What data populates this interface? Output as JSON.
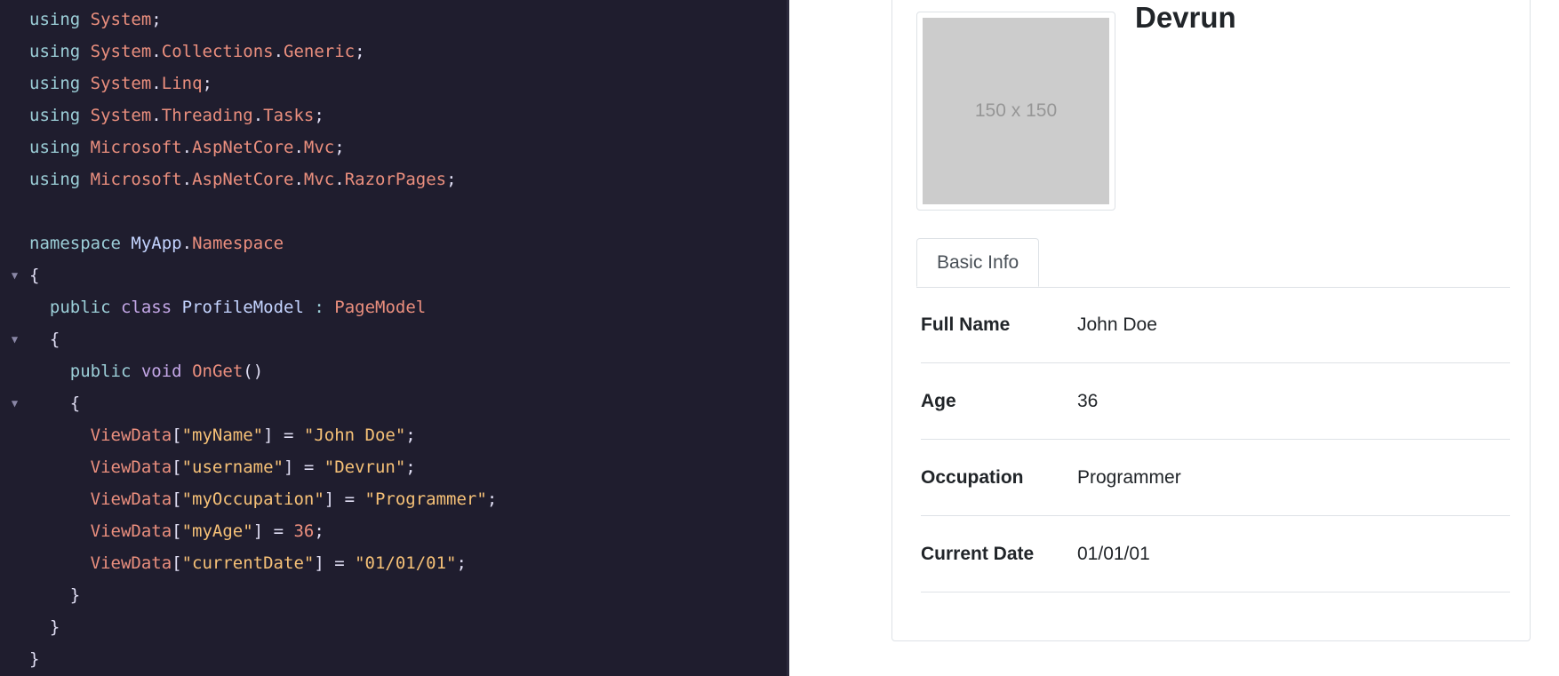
{
  "editor": {
    "lines": [
      {
        "fold": "",
        "indent": "",
        "tokens": [
          {
            "t": "using",
            "c": "kw"
          },
          {
            "t": " ",
            "c": "punc"
          },
          {
            "t": "System",
            "c": "type"
          },
          {
            "t": ";",
            "c": "punc"
          }
        ]
      },
      {
        "fold": "",
        "indent": "",
        "tokens": [
          {
            "t": "using",
            "c": "kw"
          },
          {
            "t": " ",
            "c": "punc"
          },
          {
            "t": "System",
            "c": "type"
          },
          {
            "t": ".",
            "c": "punc"
          },
          {
            "t": "Collections",
            "c": "type"
          },
          {
            "t": ".",
            "c": "punc"
          },
          {
            "t": "Generic",
            "c": "type"
          },
          {
            "t": ";",
            "c": "punc"
          }
        ]
      },
      {
        "fold": "",
        "indent": "",
        "tokens": [
          {
            "t": "using",
            "c": "kw"
          },
          {
            "t": " ",
            "c": "punc"
          },
          {
            "t": "System",
            "c": "type"
          },
          {
            "t": ".",
            "c": "punc"
          },
          {
            "t": "Linq",
            "c": "type"
          },
          {
            "t": ";",
            "c": "punc"
          }
        ]
      },
      {
        "fold": "",
        "indent": "",
        "tokens": [
          {
            "t": "using",
            "c": "kw"
          },
          {
            "t": " ",
            "c": "punc"
          },
          {
            "t": "System",
            "c": "type"
          },
          {
            "t": ".",
            "c": "punc"
          },
          {
            "t": "Threading",
            "c": "type"
          },
          {
            "t": ".",
            "c": "punc"
          },
          {
            "t": "Tasks",
            "c": "type"
          },
          {
            "t": ";",
            "c": "punc"
          }
        ]
      },
      {
        "fold": "",
        "indent": "",
        "tokens": [
          {
            "t": "using",
            "c": "kw"
          },
          {
            "t": " ",
            "c": "punc"
          },
          {
            "t": "Microsoft",
            "c": "type"
          },
          {
            "t": ".",
            "c": "punc"
          },
          {
            "t": "AspNetCore",
            "c": "type"
          },
          {
            "t": ".",
            "c": "punc"
          },
          {
            "t": "Mvc",
            "c": "type"
          },
          {
            "t": ";",
            "c": "punc"
          }
        ]
      },
      {
        "fold": "",
        "indent": "",
        "tokens": [
          {
            "t": "using",
            "c": "kw"
          },
          {
            "t": " ",
            "c": "punc"
          },
          {
            "t": "Microsoft",
            "c": "type"
          },
          {
            "t": ".",
            "c": "punc"
          },
          {
            "t": "AspNetCore",
            "c": "type"
          },
          {
            "t": ".",
            "c": "punc"
          },
          {
            "t": "Mvc",
            "c": "type"
          },
          {
            "t": ".",
            "c": "punc"
          },
          {
            "t": "RazorPages",
            "c": "type"
          },
          {
            "t": ";",
            "c": "punc"
          }
        ]
      },
      {
        "fold": "",
        "indent": "",
        "tokens": []
      },
      {
        "fold": "",
        "indent": "",
        "tokens": [
          {
            "t": "namespace",
            "c": "kw"
          },
          {
            "t": " ",
            "c": "punc"
          },
          {
            "t": "MyApp",
            "c": "ident"
          },
          {
            "t": ".",
            "c": "punc"
          },
          {
            "t": "Namespace",
            "c": "type"
          }
        ]
      },
      {
        "fold": "▼",
        "indent": "",
        "tokens": [
          {
            "t": "{",
            "c": "punc"
          }
        ]
      },
      {
        "fold": "",
        "indent": "  ",
        "tokens": [
          {
            "t": "public",
            "c": "kw"
          },
          {
            "t": " ",
            "c": "punc"
          },
          {
            "t": "class",
            "c": "kw2"
          },
          {
            "t": " ",
            "c": "punc"
          },
          {
            "t": "ProfileModel",
            "c": "ident"
          },
          {
            "t": " : ",
            "c": "kw"
          },
          {
            "t": "PageModel",
            "c": "type"
          }
        ]
      },
      {
        "fold": "▼",
        "indent": "  ",
        "tokens": [
          {
            "t": "{",
            "c": "punc"
          }
        ]
      },
      {
        "fold": "",
        "indent": "    ",
        "tokens": [
          {
            "t": "public",
            "c": "kw"
          },
          {
            "t": " ",
            "c": "punc"
          },
          {
            "t": "void",
            "c": "kw2"
          },
          {
            "t": " ",
            "c": "punc"
          },
          {
            "t": "OnGet",
            "c": "type"
          },
          {
            "t": "()",
            "c": "punc"
          }
        ]
      },
      {
        "fold": "▼",
        "indent": "    ",
        "tokens": [
          {
            "t": "{",
            "c": "punc"
          }
        ]
      },
      {
        "fold": "",
        "indent": "      ",
        "tokens": [
          {
            "t": "ViewData",
            "c": "type"
          },
          {
            "t": "[",
            "c": "punc"
          },
          {
            "t": "\"myName\"",
            "c": "str"
          },
          {
            "t": "] = ",
            "c": "punc"
          },
          {
            "t": "\"John Doe\"",
            "c": "str"
          },
          {
            "t": ";",
            "c": "punc"
          }
        ]
      },
      {
        "fold": "",
        "indent": "      ",
        "tokens": [
          {
            "t": "ViewData",
            "c": "type"
          },
          {
            "t": "[",
            "c": "punc"
          },
          {
            "t": "\"username\"",
            "c": "str"
          },
          {
            "t": "] = ",
            "c": "punc"
          },
          {
            "t": "\"Devrun\"",
            "c": "str"
          },
          {
            "t": ";",
            "c": "punc"
          }
        ]
      },
      {
        "fold": "",
        "indent": "      ",
        "tokens": [
          {
            "t": "ViewData",
            "c": "type"
          },
          {
            "t": "[",
            "c": "punc"
          },
          {
            "t": "\"myOccupation\"",
            "c": "str"
          },
          {
            "t": "] = ",
            "c": "punc"
          },
          {
            "t": "\"Programmer\"",
            "c": "str"
          },
          {
            "t": ";",
            "c": "punc"
          }
        ]
      },
      {
        "fold": "",
        "indent": "      ",
        "tokens": [
          {
            "t": "ViewData",
            "c": "type"
          },
          {
            "t": "[",
            "c": "punc"
          },
          {
            "t": "\"myAge\"",
            "c": "str"
          },
          {
            "t": "] = ",
            "c": "punc"
          },
          {
            "t": "36",
            "c": "num"
          },
          {
            "t": ";",
            "c": "punc"
          }
        ]
      },
      {
        "fold": "",
        "indent": "      ",
        "tokens": [
          {
            "t": "ViewData",
            "c": "type"
          },
          {
            "t": "[",
            "c": "punc"
          },
          {
            "t": "\"currentDate\"",
            "c": "str"
          },
          {
            "t": "] = ",
            "c": "punc"
          },
          {
            "t": "\"01/01/01\"",
            "c": "str"
          },
          {
            "t": ";",
            "c": "punc"
          }
        ]
      },
      {
        "fold": "",
        "indent": "    ",
        "tokens": [
          {
            "t": "}",
            "c": "punc"
          }
        ]
      },
      {
        "fold": "",
        "indent": "  ",
        "tokens": [
          {
            "t": "}",
            "c": "punc"
          }
        ]
      },
      {
        "fold": "",
        "indent": "",
        "tokens": [
          {
            "t": "}",
            "c": "punc"
          }
        ]
      }
    ]
  },
  "preview": {
    "avatar_placeholder": "150 x 150",
    "title": "Devrun",
    "tab_label": "Basic Info",
    "rows": [
      {
        "key": "Full Name",
        "value": "John Doe"
      },
      {
        "key": "Age",
        "value": "36"
      },
      {
        "key": "Occupation",
        "value": "Programmer"
      },
      {
        "key": "Current Date",
        "value": "01/01/01"
      }
    ]
  },
  "colors": {
    "editor_bg": "#1f1d2e",
    "keyword": "#9ccfd8",
    "type": "#eb8f7e",
    "string": "#f6c177",
    "placeholder_bg": "#cccccc"
  }
}
